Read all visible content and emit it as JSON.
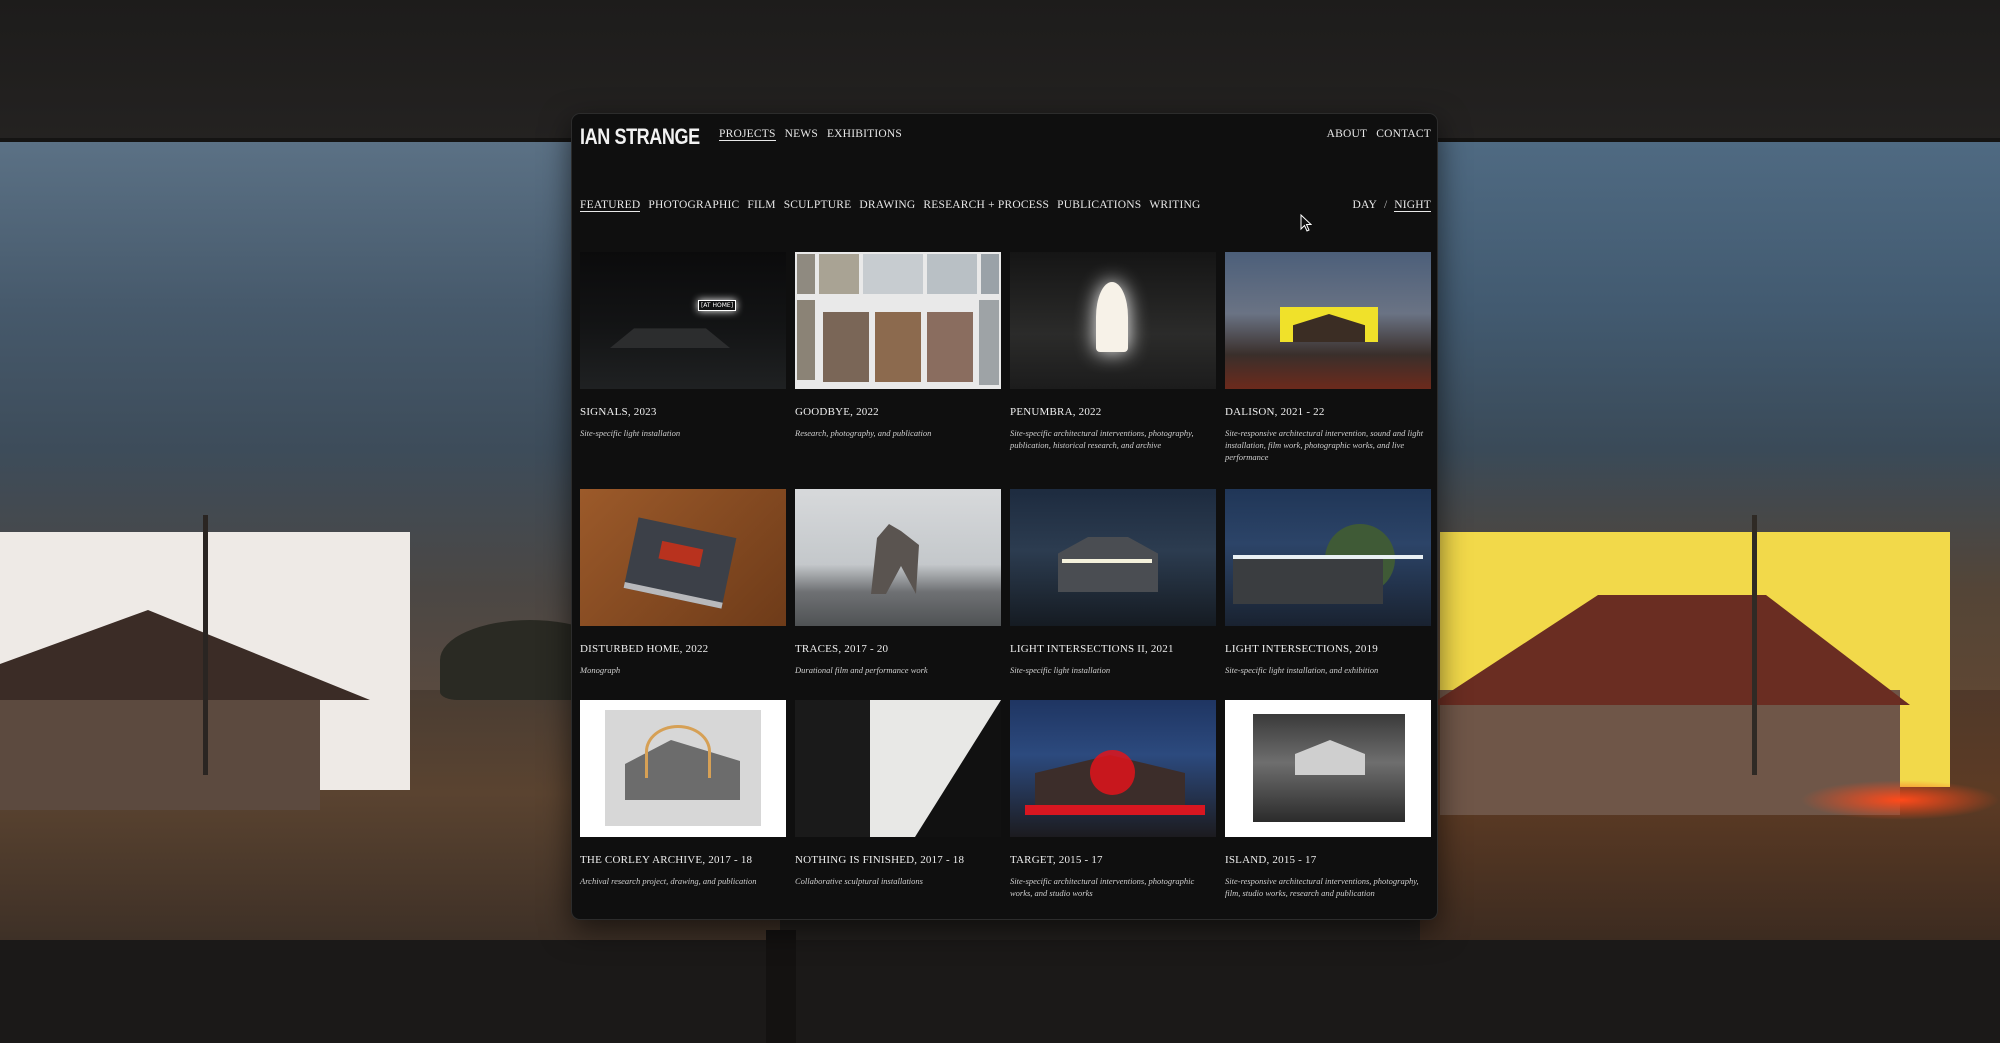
{
  "site": {
    "logo": "IAN STRANGE"
  },
  "main_nav": [
    {
      "label": "PROJECTS",
      "active": true
    },
    {
      "label": "NEWS",
      "active": false
    },
    {
      "label": "EXHIBITIONS",
      "active": false
    }
  ],
  "right_nav": [
    {
      "label": "ABOUT"
    },
    {
      "label": "CONTACT"
    }
  ],
  "filters": [
    {
      "label": "FEATURED",
      "active": true
    },
    {
      "label": "PHOTOGRAPHIC",
      "active": false
    },
    {
      "label": "FILM",
      "active": false
    },
    {
      "label": "SCULPTURE",
      "active": false
    },
    {
      "label": "DRAWING",
      "active": false
    },
    {
      "label": "RESEARCH + PROCESS",
      "active": false
    },
    {
      "label": "PUBLICATIONS",
      "active": false
    },
    {
      "label": "WRITING",
      "active": false
    }
  ],
  "mode_toggle": {
    "day": "DAY",
    "separator": "/",
    "night": "NIGHT",
    "active": "night"
  },
  "projects": [
    {
      "title": "SIGNALS, 2023",
      "description": "Site-specific light installation",
      "sign_text": "[AT HOME]"
    },
    {
      "title": "GOODBYE, 2022",
      "description": "Research, photography, and publication"
    },
    {
      "title": "PENUMBRA, 2022",
      "description": "Site-specific architectural interventions, photography, publication, historical research, and archive"
    },
    {
      "title": "DALISON, 2021 - 22",
      "description": "Site-responsive architectural intervention, sound and light installation, film work, photographic works, and live performance"
    },
    {
      "title": "DISTURBED HOME, 2022",
      "description": "Monograph"
    },
    {
      "title": "TRACES, 2017 - 20",
      "description": "Durational film and performance work"
    },
    {
      "title": "LIGHT INTERSECTIONS II, 2021",
      "description": "Site-specific light installation"
    },
    {
      "title": "LIGHT INTERSECTIONS, 2019",
      "description": "Site-specific light installation, and exhibition"
    },
    {
      "title": "THE CORLEY ARCHIVE, 2017 - 18",
      "description": "Archival research project, drawing, and publication"
    },
    {
      "title": "NOTHING IS FINISHED, 2017 - 18",
      "description": "Collaborative sculptural installations"
    },
    {
      "title": "TARGET, 2015 - 17",
      "description": "Site-specific architectural interventions, photographic works, and studio works"
    },
    {
      "title": "ISLAND, 2015 - 17",
      "description": "Site-responsive architectural interventions, photography, film, studio works, research and publication"
    }
  ],
  "colors": {
    "window_bg": "#0f0f0f",
    "text": "#efefef",
    "accent_yellow": "#f2d94a",
    "accent_red": "#e0141b"
  }
}
